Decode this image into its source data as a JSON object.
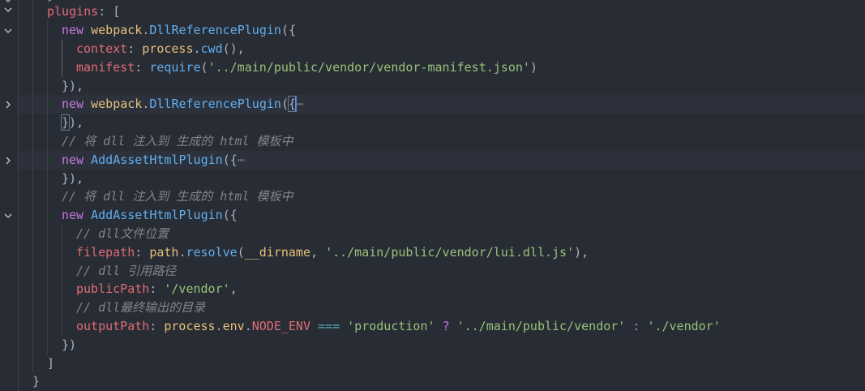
{
  "editor": {
    "lines": [
      {
        "parts": [
          [
            "punc",
            "}"
          ]
        ]
      },
      {
        "parts": [
          [
            "prop",
            "plugins"
          ],
          [
            "punc",
            ": ["
          ]
        ]
      },
      {
        "parts": [
          [
            "kw",
            "new "
          ],
          [
            "var",
            "webpack"
          ],
          [
            "punc",
            "."
          ],
          [
            "fn",
            "DllReferencePlugin"
          ],
          [
            "punc",
            "({"
          ]
        ]
      },
      {
        "parts": [
          [
            "prop",
            "context"
          ],
          [
            "punc",
            ": "
          ],
          [
            "var",
            "process"
          ],
          [
            "punc",
            "."
          ],
          [
            "fn",
            "cwd"
          ],
          [
            "punc",
            "(),"
          ]
        ]
      },
      {
        "parts": [
          [
            "prop",
            "manifest"
          ],
          [
            "punc",
            ": "
          ],
          [
            "fn",
            "require"
          ],
          [
            "punc",
            "("
          ],
          [
            "str",
            "'../main/public/vendor/vendor-manifest.json'"
          ],
          [
            "punc",
            ")"
          ]
        ]
      },
      {
        "parts": [
          [
            "punc",
            "}),"
          ]
        ]
      },
      {
        "parts": [
          [
            "kw",
            "new "
          ],
          [
            "var",
            "webpack"
          ],
          [
            "punc",
            "."
          ],
          [
            "fn",
            "DllReferencePlugin"
          ],
          [
            "punc",
            "("
          ],
          [
            "punc",
            "{"
          ],
          [
            "ellipsis",
            "⋯"
          ]
        ]
      },
      {
        "parts": [
          [
            "punc",
            "}"
          ],
          [
            "punc",
            "),"
          ]
        ]
      },
      {
        "parts": [
          [
            "cm",
            "// 将 dll 注入到 生成的 html 模板中"
          ]
        ]
      },
      {
        "parts": [
          [
            "kw",
            "new "
          ],
          [
            "fn",
            "AddAssetHtmlPlugin"
          ],
          [
            "punc",
            "({"
          ],
          [
            "ellipsis",
            "⋯"
          ]
        ]
      },
      {
        "parts": [
          [
            "punc",
            "}),"
          ]
        ]
      },
      {
        "parts": [
          [
            "cm",
            "// 将 dll 注入到 生成的 html 模板中"
          ]
        ]
      },
      {
        "parts": [
          [
            "kw",
            "new "
          ],
          [
            "fn",
            "AddAssetHtmlPlugin"
          ],
          [
            "punc",
            "({"
          ]
        ]
      },
      {
        "parts": [
          [
            "cm",
            "// dll文件位置"
          ]
        ]
      },
      {
        "parts": [
          [
            "prop",
            "filepath"
          ],
          [
            "punc",
            ": "
          ],
          [
            "var",
            "path"
          ],
          [
            "punc",
            "."
          ],
          [
            "fn",
            "resolve"
          ],
          [
            "punc",
            "("
          ],
          [
            "var",
            "__dirname"
          ],
          [
            "punc",
            ", "
          ],
          [
            "str",
            "'../main/public/vendor/lui.dll.js'"
          ],
          [
            "punc",
            "),"
          ]
        ]
      },
      {
        "parts": [
          [
            "cm",
            "// dll 引用路径"
          ]
        ]
      },
      {
        "parts": [
          [
            "prop",
            "publicPath"
          ],
          [
            "punc",
            ": "
          ],
          [
            "str",
            "'/vendor'"
          ],
          [
            "punc",
            ","
          ]
        ]
      },
      {
        "parts": [
          [
            "cm",
            "// dll最终输出的目录"
          ]
        ]
      },
      {
        "parts": [
          [
            "prop",
            "outputPath"
          ],
          [
            "punc",
            ": "
          ],
          [
            "var",
            "process"
          ],
          [
            "punc",
            "."
          ],
          [
            "var",
            "env"
          ],
          [
            "punc",
            "."
          ],
          [
            "prop",
            "NODE_ENV"
          ],
          [
            "punc",
            " "
          ],
          [
            "op",
            "==="
          ],
          [
            "punc",
            " "
          ],
          [
            "str",
            "'production'"
          ],
          [
            "punc",
            " "
          ],
          [
            "kw",
            "?"
          ],
          [
            "punc",
            " "
          ],
          [
            "str",
            "'../main/public/vendor'"
          ],
          [
            "punc",
            " "
          ],
          [
            "kw",
            ":"
          ],
          [
            "punc",
            " "
          ],
          [
            "str",
            "'./vendor'"
          ]
        ]
      },
      {
        "parts": [
          [
            "punc",
            "})"
          ]
        ]
      },
      {
        "parts": [
          [
            "punc",
            "]"
          ]
        ]
      },
      {
        "parts": [
          [
            "punc",
            "}"
          ]
        ]
      }
    ]
  }
}
